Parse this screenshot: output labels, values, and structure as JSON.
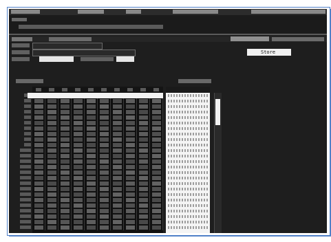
{
  "app": {
    "window_title": "",
    "title_line": "",
    "device_line": ""
  },
  "form": {
    "section_label": "",
    "store_button": "Store",
    "port_value": "",
    "mode_value": "",
    "field_value": ""
  },
  "table": {
    "section_label": "",
    "ascii_header": ""
  },
  "colors": {
    "screen_bg": "#1e1e1e",
    "text": "#cfcfcf",
    "highlight": "#f2f2f2",
    "frame_border": "#4f80c8"
  }
}
